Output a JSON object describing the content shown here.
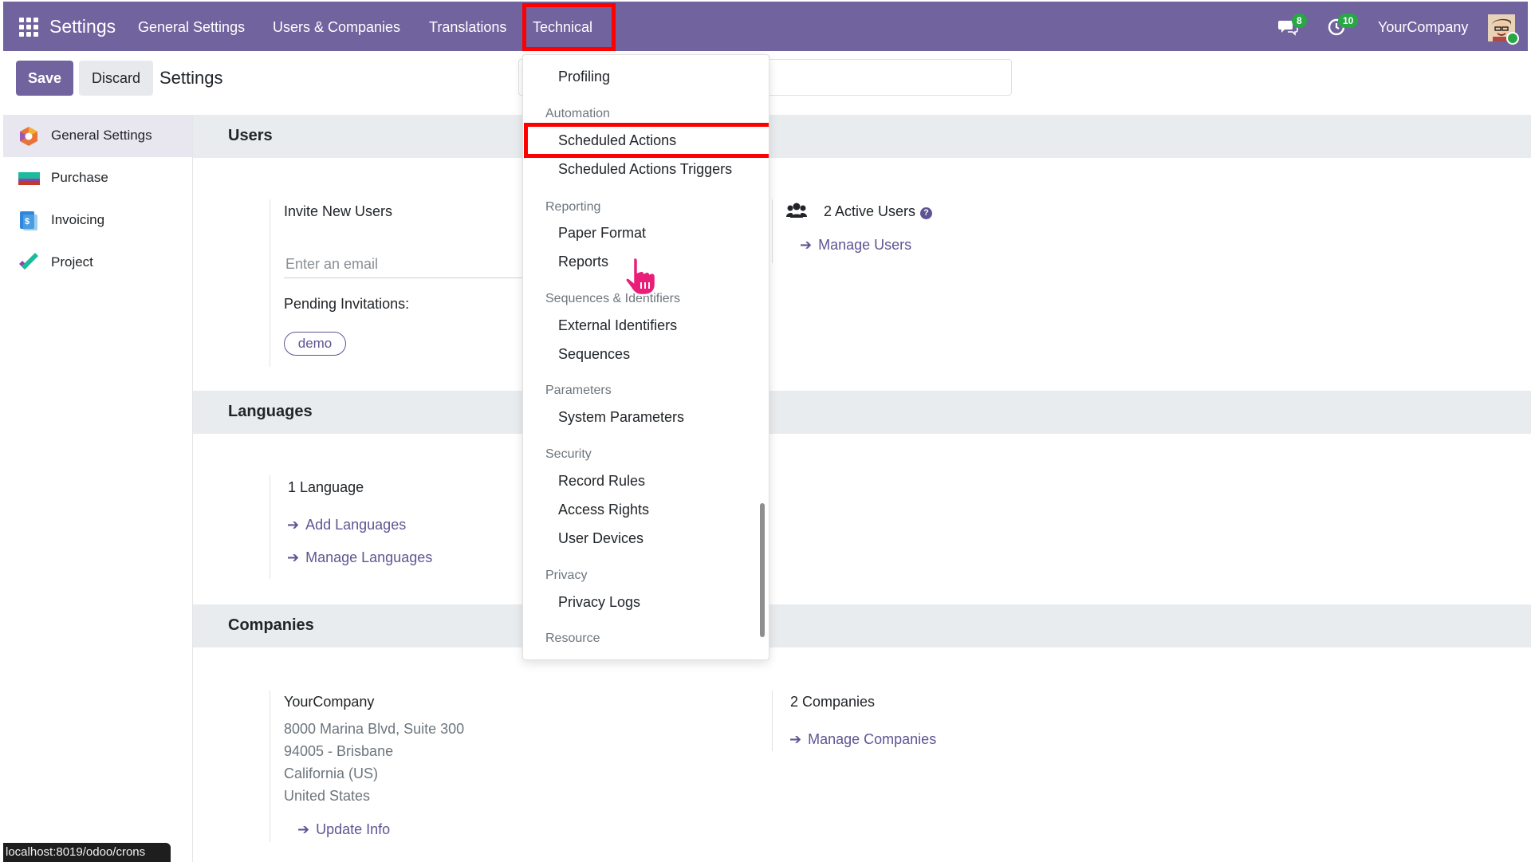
{
  "navbar": {
    "brand": "Settings",
    "menus": [
      "General Settings",
      "Users & Companies",
      "Translations",
      "Technical"
    ],
    "chat_count": "8",
    "activity_count": "10",
    "company": "YourCompany"
  },
  "control_panel": {
    "save_label": "Save",
    "discard_label": "Discard",
    "title": "Settings"
  },
  "sidebar": {
    "items": [
      {
        "label": "General Settings",
        "icon": "settings-app-icon"
      },
      {
        "label": "Purchase",
        "icon": "purchase-app-icon"
      },
      {
        "label": "Invoicing",
        "icon": "invoicing-app-icon"
      },
      {
        "label": "Project",
        "icon": "project-app-icon"
      }
    ]
  },
  "users": {
    "title": "Users",
    "invite_label": "Invite New Users",
    "email_placeholder": "Enter an email",
    "pending_label": "Pending Invitations:",
    "pending_tag": "demo",
    "active_users": "2 Active Users",
    "manage_users": "Manage Users"
  },
  "languages": {
    "title": "Languages",
    "count": "1 Language",
    "add": "Add Languages",
    "manage": "Manage Languages"
  },
  "companies": {
    "title": "Companies",
    "name": "YourCompany",
    "address": [
      "8000 Marina Blvd, Suite 300",
      "94005 - Brisbane",
      "California (US)",
      "United States"
    ],
    "update": "Update Info",
    "count": "2 Companies",
    "manage": "Manage Companies"
  },
  "dropdown": {
    "profiling": "Profiling",
    "automation_header": "Automation",
    "scheduled_actions": "Scheduled Actions",
    "scheduled_triggers": "Scheduled Actions Triggers",
    "reporting_header": "Reporting",
    "paper_format": "Paper Format",
    "reports": "Reports",
    "sequences_header": "Sequences & Identifiers",
    "external_ids": "External Identifiers",
    "sequences": "Sequences",
    "parameters_header": "Parameters",
    "system_parameters": "System Parameters",
    "security_header": "Security",
    "record_rules": "Record Rules",
    "access_rights": "Access Rights",
    "user_devices": "User Devices",
    "privacy_header": "Privacy",
    "privacy_logs": "Privacy Logs",
    "resource_header": "Resource"
  },
  "status_url": "localhost:8019/odoo/crons",
  "colors": {
    "navbar": "#71639e",
    "accent": "#5f5493",
    "highlight": "#ff0000",
    "badge": "#28a745"
  }
}
